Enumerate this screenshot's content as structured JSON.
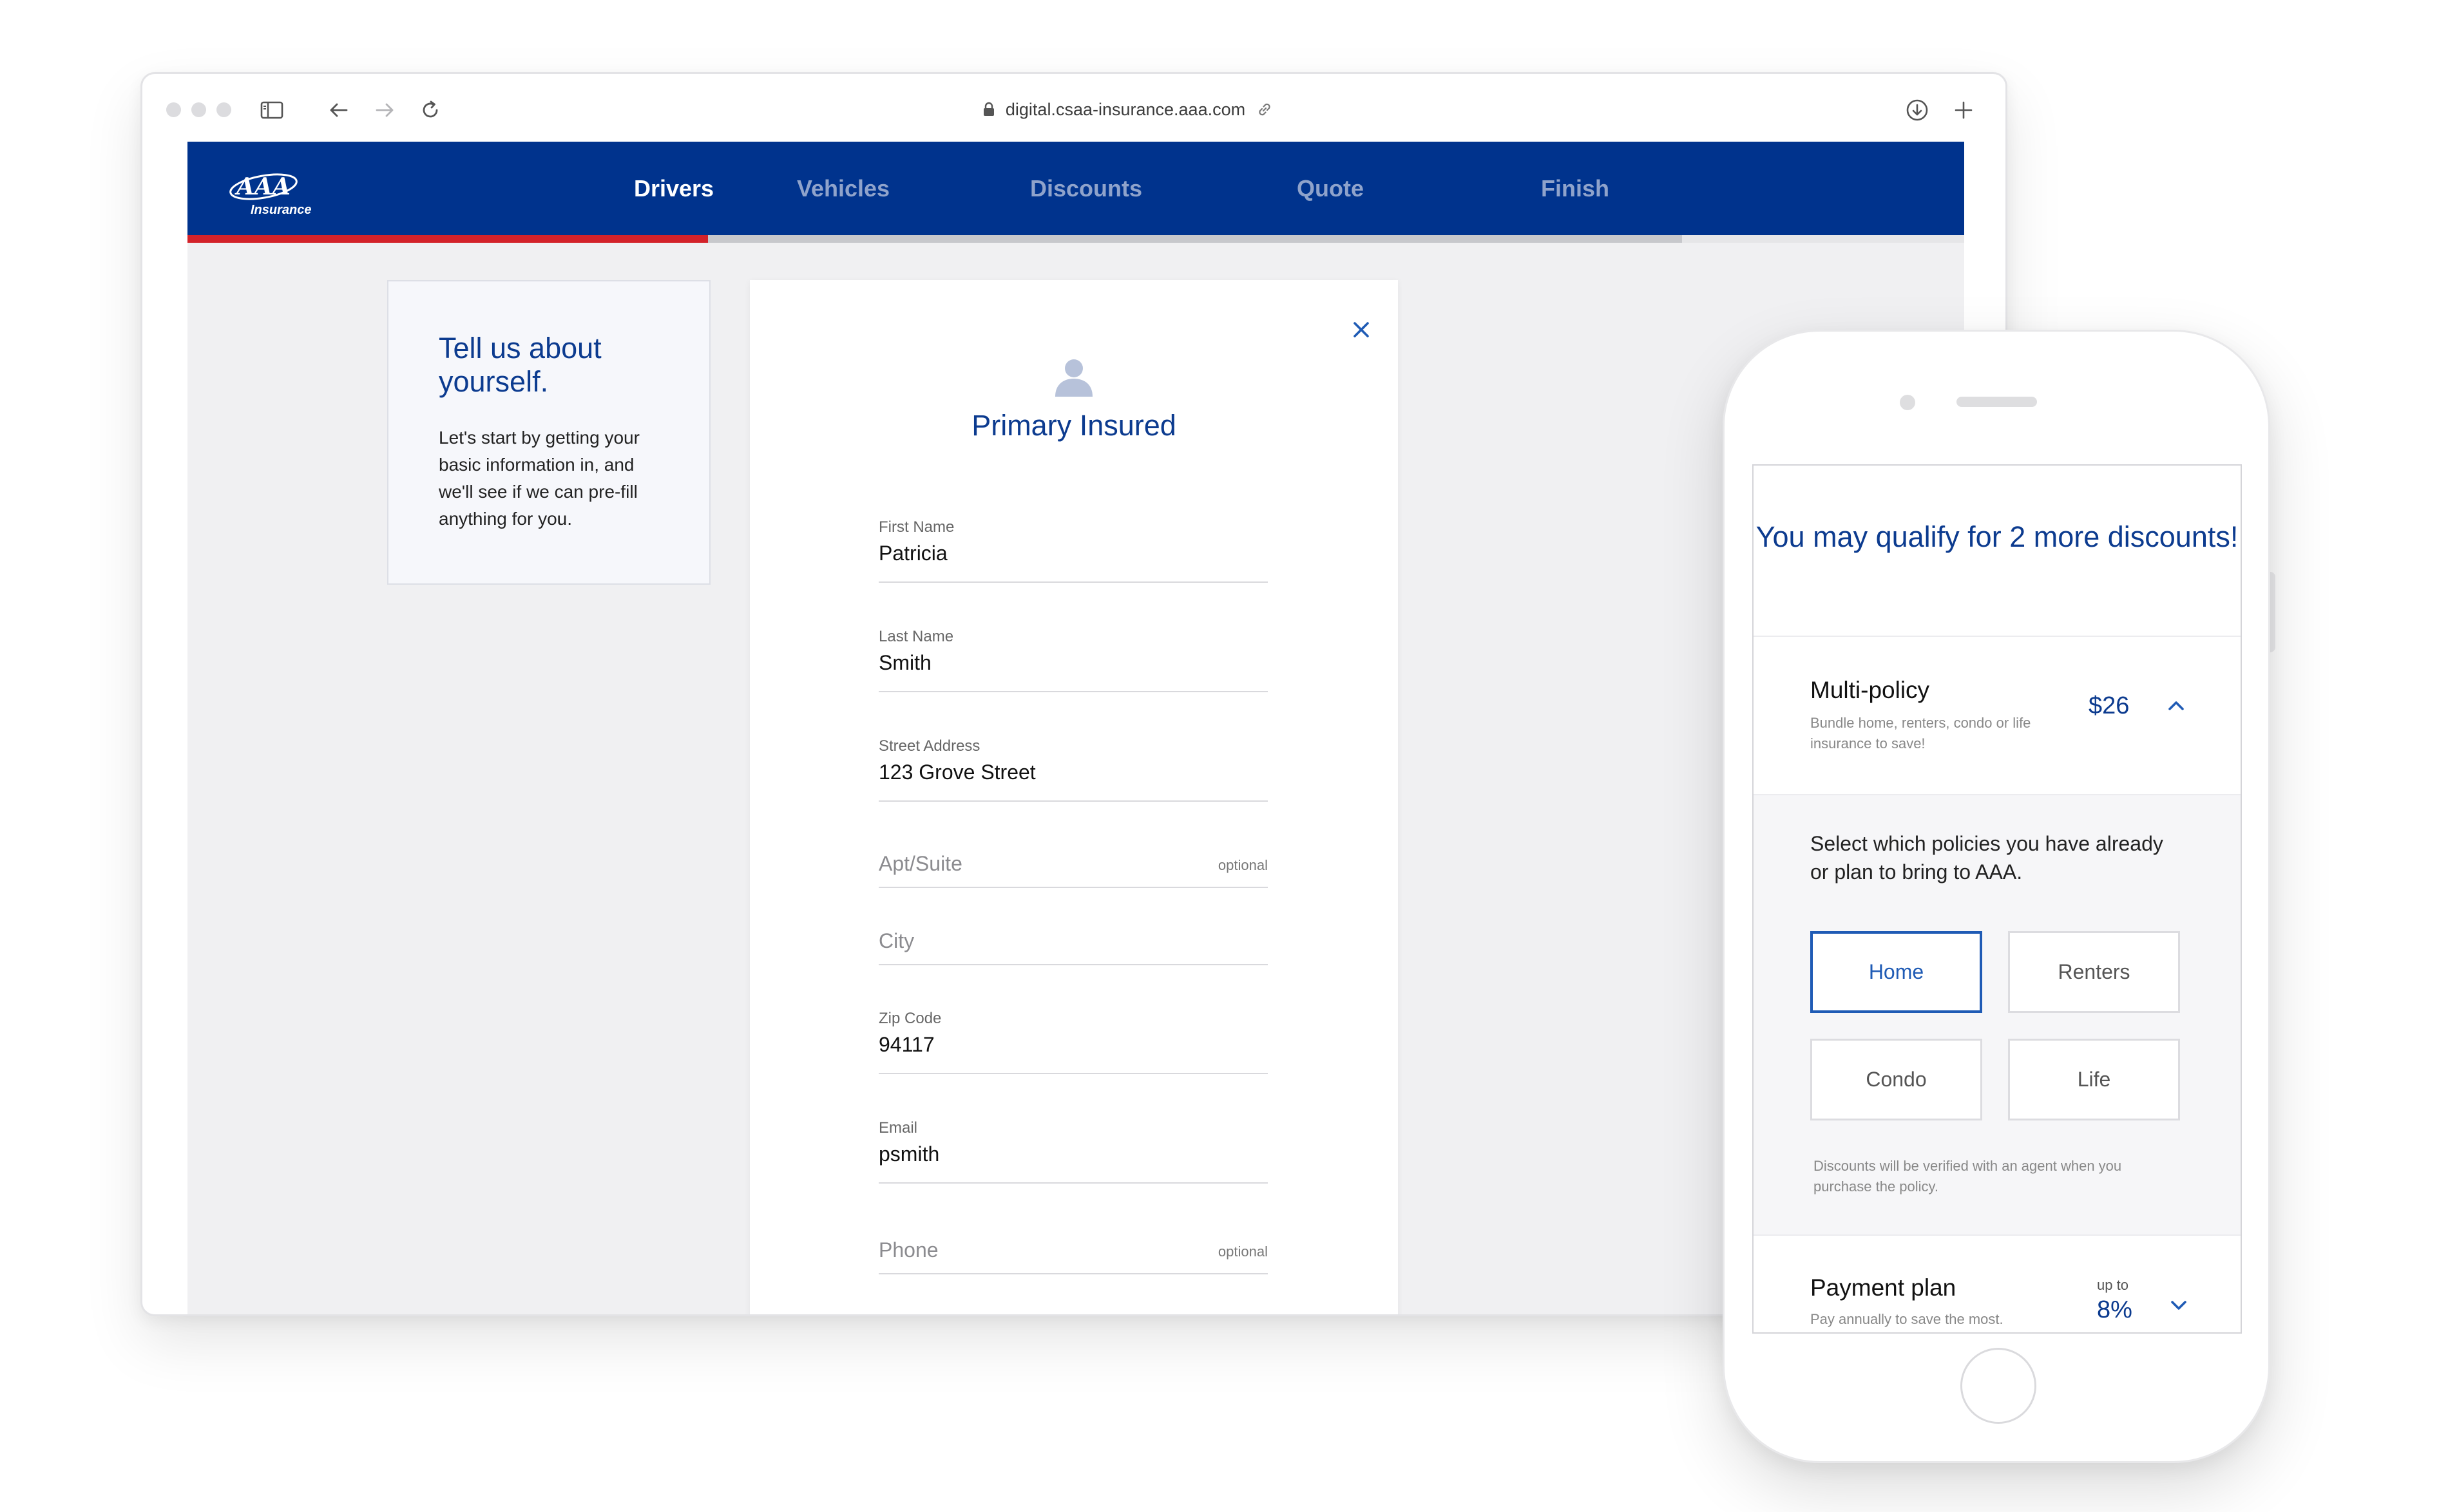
{
  "browser": {
    "url": "digital.csaa-insurance.aaa.com"
  },
  "brand": {
    "logo_letters": "AAA",
    "logo_word": "Insurance",
    "primary_color": "#00338d",
    "accent_red": "#d3222a"
  },
  "nav": {
    "tabs": [
      {
        "label": "Drivers",
        "active": true
      },
      {
        "label": "Vehicles",
        "active": false
      },
      {
        "label": "Discounts",
        "active": false
      },
      {
        "label": "Quote",
        "active": false
      },
      {
        "label": "Finish",
        "active": false
      }
    ]
  },
  "intro": {
    "title": "Tell us about yourself.",
    "body": "Let's start by getting your basic information in, and we'll see if we can pre-fill anything for you."
  },
  "form": {
    "title": "Primary Insured",
    "icons": {
      "close": "close-icon",
      "person": "person-icon"
    },
    "fields": {
      "first_name": {
        "label": "First Name",
        "value": "Patricia"
      },
      "last_name": {
        "label": "Last Name",
        "value": "Smith"
      },
      "street": {
        "label": "Street Address",
        "value": "123 Grove Street"
      },
      "apt": {
        "placeholder": "Apt/Suite",
        "optional": "optional"
      },
      "city": {
        "placeholder": "City"
      },
      "zip": {
        "label": "Zip Code",
        "value": "94117"
      },
      "email": {
        "label": "Email",
        "value": "psmith"
      },
      "phone": {
        "placeholder": "Phone",
        "optional": "optional"
      }
    }
  },
  "mobile": {
    "title": "You may qualify for 2 more discounts!",
    "multi_policy": {
      "title": "Multi-policy",
      "subtitle": "Bundle home, renters, condo or life insurance to save!",
      "amount": "$26",
      "instructions": "Select which policies you have already or plan to bring to AAA.",
      "options": [
        {
          "label": "Home",
          "selected": true
        },
        {
          "label": "Renters",
          "selected": false
        },
        {
          "label": "Condo",
          "selected": false
        },
        {
          "label": "Life",
          "selected": false
        }
      ],
      "note": "Discounts will be verified with an agent when you purchase the policy."
    },
    "payment_plan": {
      "title": "Payment plan",
      "subtitle": "Pay annually to save the most.",
      "up_to": "up to",
      "amount": "8%"
    }
  }
}
